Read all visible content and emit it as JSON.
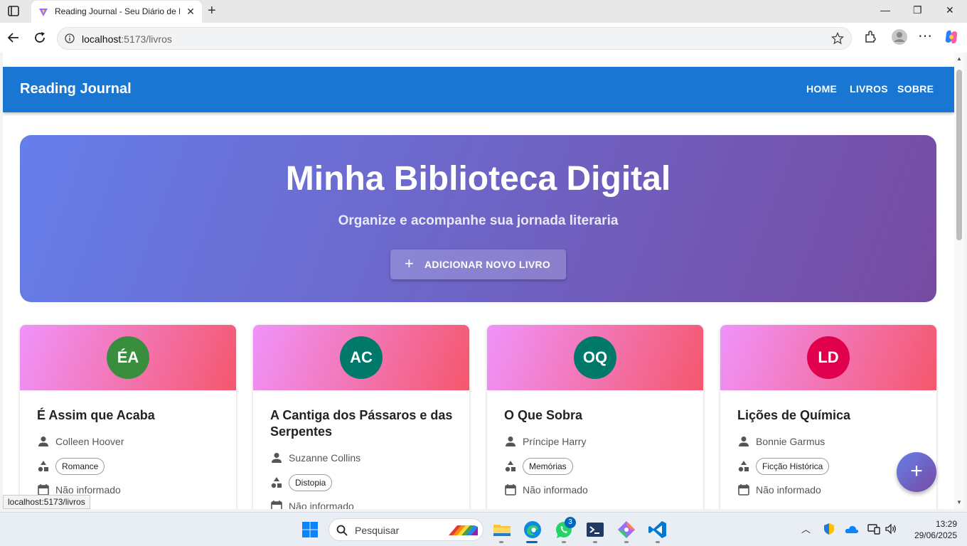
{
  "browser": {
    "tab_title": "Reading Journal - Seu Diário de Leitura",
    "url_host": "localhost",
    "url_rest": ":5173/livros",
    "status_url": "localhost:5173/livros"
  },
  "app": {
    "brand": "Reading Journal",
    "nav": [
      "HOME",
      "LIVROS",
      "SOBRE"
    ]
  },
  "hero": {
    "title": "Minha Biblioteca Digital",
    "subtitle": "Organize e acompanhe sua jornada literaria",
    "button": "ADICIONAR NOVO LIVRO"
  },
  "books": [
    {
      "initials": "ÉA",
      "avatar_color": "#388e3c",
      "title": "É Assim que Acaba",
      "author": "Colleen Hoover",
      "genre": "Romance",
      "date": "Não informado"
    },
    {
      "initials": "AC",
      "avatar_color": "#00796b",
      "title": "A Cantiga dos Pássaros e das Serpentes",
      "author": "Suzanne Collins",
      "genre": "Distopia",
      "date": "Não informado"
    },
    {
      "initials": "OQ",
      "avatar_color": "#00796b",
      "title": "O Que Sobra",
      "author": "Príncipe Harry",
      "genre": "Memórias",
      "date": "Não informado"
    },
    {
      "initials": "LD",
      "avatar_color": "#e0004d",
      "title": "Lições de Química",
      "author": "Bonnie Garmus",
      "genre": "Ficção Histórica",
      "date": "Não informado"
    }
  ],
  "fab_label": "+",
  "taskbar": {
    "search_placeholder": "Pesquisar",
    "whatsapp_badge": "3",
    "time": "13:29",
    "date": "29/06/2025"
  },
  "colors": {
    "appbar": "#1976d2",
    "hero_gradient": [
      "#667eea",
      "#764ba2"
    ],
    "card_gradient": [
      "#f093fb",
      "#f5576c"
    ]
  }
}
